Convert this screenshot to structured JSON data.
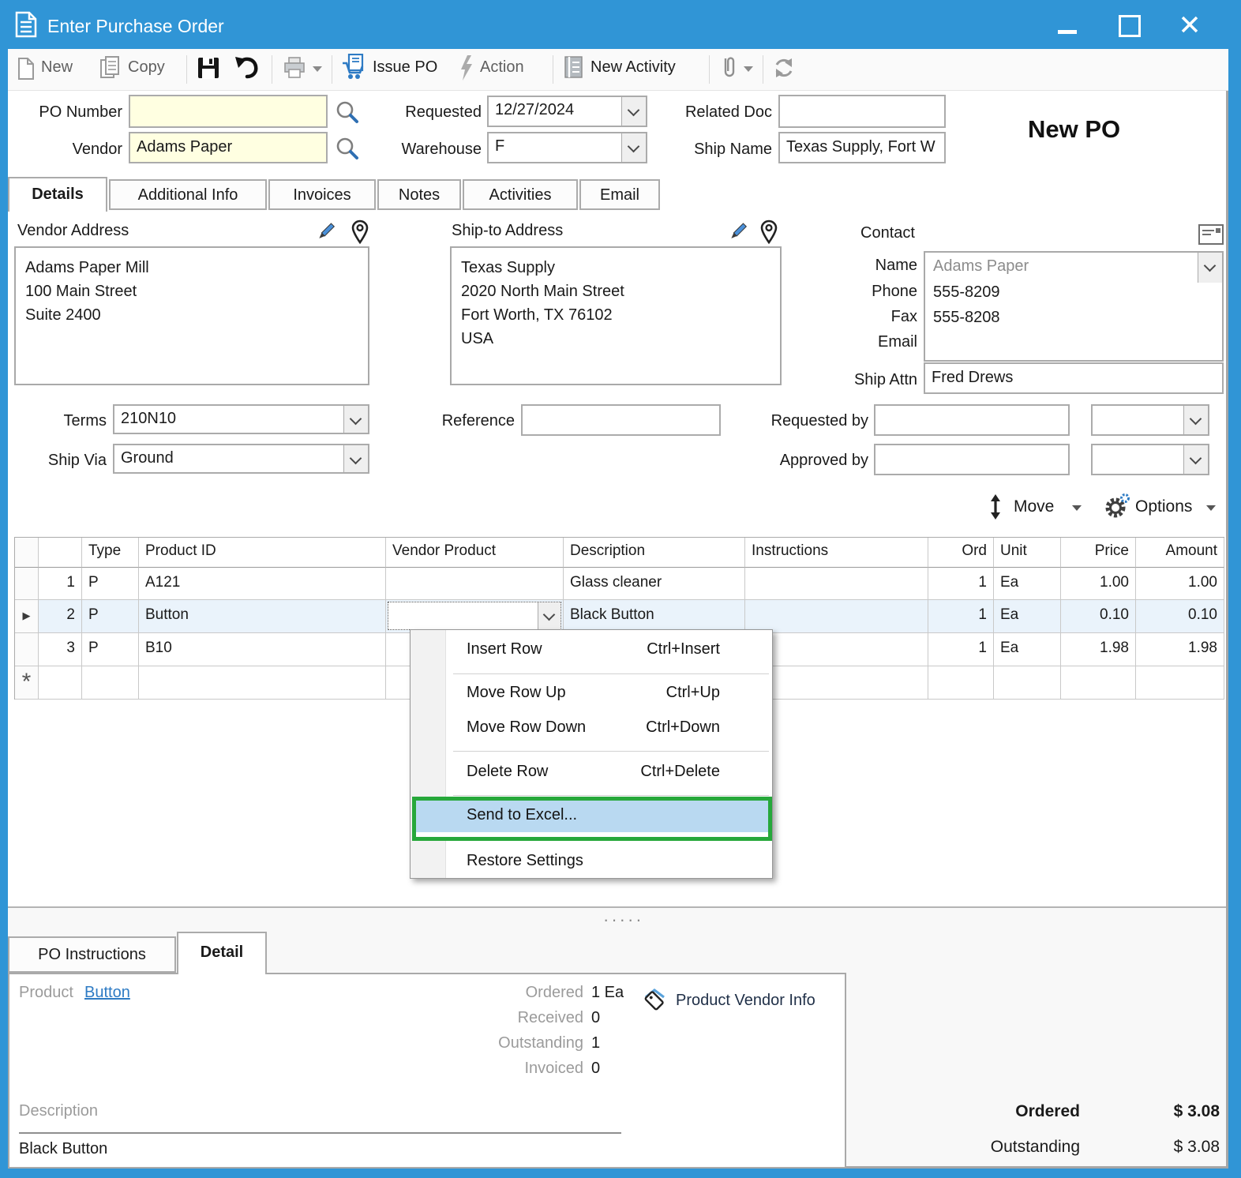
{
  "window": {
    "title": "Enter Purchase Order"
  },
  "toolbar": {
    "new": "New",
    "copy": "Copy",
    "issue_po": "Issue PO",
    "action": "Action",
    "new_activity": "New Activity"
  },
  "header": {
    "po_number_label": "PO Number",
    "po_number": "",
    "vendor_label": "Vendor",
    "vendor": "Adams Paper",
    "requested_label": "Requested",
    "requested": "12/27/2024",
    "warehouse_label": "Warehouse",
    "warehouse": "F",
    "related_doc_label": "Related Doc",
    "related_doc": "",
    "ship_name_label": "Ship Name",
    "ship_name": "Texas Supply, Fort W",
    "status": "New PO"
  },
  "tabs": {
    "details": "Details",
    "additional_info": "Additional Info",
    "invoices": "Invoices",
    "notes": "Notes",
    "activities": "Activities",
    "email": "Email"
  },
  "addresses": {
    "vendor_label": "Vendor Address",
    "vendor_l1": "Adams Paper Mill",
    "vendor_l2": "100 Main Street",
    "vendor_l3": "Suite 2400",
    "ship_label": "Ship-to Address",
    "ship_l1": "Texas Supply",
    "ship_l2": "2020 North Main Street",
    "ship_l3": "Fort Worth, TX 76102",
    "ship_l4": "USA"
  },
  "contact": {
    "label": "Contact",
    "name_label": "Name",
    "name": "Adams Paper",
    "phone_label": "Phone",
    "phone": "555-8209",
    "fax_label": "Fax",
    "fax": "555-8208",
    "email_label": "Email",
    "email": "",
    "ship_attn_label": "Ship Attn",
    "ship_attn": "Fred Drews"
  },
  "order": {
    "terms_label": "Terms",
    "terms": "210N10",
    "ship_via_label": "Ship Via",
    "ship_via": "Ground",
    "reference_label": "Reference",
    "reference": "",
    "requested_by_label": "Requested by",
    "requested_by": "",
    "approved_by_label": "Approved by",
    "approved_by": "",
    "move_label": "Move",
    "options_label": "Options"
  },
  "grid": {
    "headers": {
      "type": "Type",
      "product_id": "Product ID",
      "vendor_product": "Vendor Product",
      "description": "Description",
      "instructions": "Instructions",
      "ord": "Ord",
      "unit": "Unit",
      "price": "Price",
      "amount": "Amount"
    },
    "rows": [
      {
        "num": "1",
        "type": "P",
        "product_id": "A121",
        "vendor_product": "",
        "description": "Glass cleaner",
        "instructions": "",
        "ord": "1",
        "unit": "Ea",
        "price": "1.00",
        "amount": "1.00"
      },
      {
        "num": "2",
        "type": "P",
        "product_id": "Button",
        "vendor_product": "",
        "description": "Black Button",
        "instructions": "",
        "ord": "1",
        "unit": "Ea",
        "price": "0.10",
        "amount": "0.10"
      },
      {
        "num": "3",
        "type": "P",
        "product_id": "B10",
        "vendor_product": "",
        "description": "",
        "instructions": "",
        "ord": "1",
        "unit": "Ea",
        "price": "1.98",
        "amount": "1.98"
      }
    ],
    "selected_row_arrow": "▶",
    "new_row_glyph": "*"
  },
  "context_menu": {
    "items": [
      {
        "label": "Insert Row",
        "shortcut": "Ctrl+Insert"
      },
      {
        "label": "Move Row Up",
        "shortcut": "Ctrl+Up"
      },
      {
        "label": "Move Row Down",
        "shortcut": "Ctrl+Down"
      },
      {
        "label": "Delete Row",
        "shortcut": "Ctrl+Delete"
      },
      {
        "label": "Send to Excel...",
        "shortcut": ""
      },
      {
        "label": "Restore Settings",
        "shortcut": ""
      }
    ]
  },
  "bottom": {
    "splitter_dots": "·····",
    "tab_po_instructions": "PO Instructions",
    "tab_detail": "Detail",
    "product_label": "Product",
    "product_link": "Button",
    "ordered_label": "Ordered",
    "ordered_value": "1 Ea",
    "received_label": "Received",
    "received_value": "0",
    "outstanding_label": "Outstanding",
    "outstanding_value": "1",
    "invoiced_label": "Invoiced",
    "invoiced_value": "0",
    "vendor_info_label": "Product Vendor Info",
    "description_label": "Description",
    "description_value": "Black Button"
  },
  "totals": {
    "ordered_label": "Ordered",
    "ordered_value": "$ 3.08",
    "outstanding_label": "Outstanding",
    "outstanding_value": "$ 3.08"
  },
  "colors": {
    "titlebar_blue": "#3095D6",
    "field_yellow": "#FFFFE1",
    "selection_blue": "#EAF3FB",
    "menu_highlight": "#B9D9F1",
    "annotation_green": "#27A83B"
  }
}
